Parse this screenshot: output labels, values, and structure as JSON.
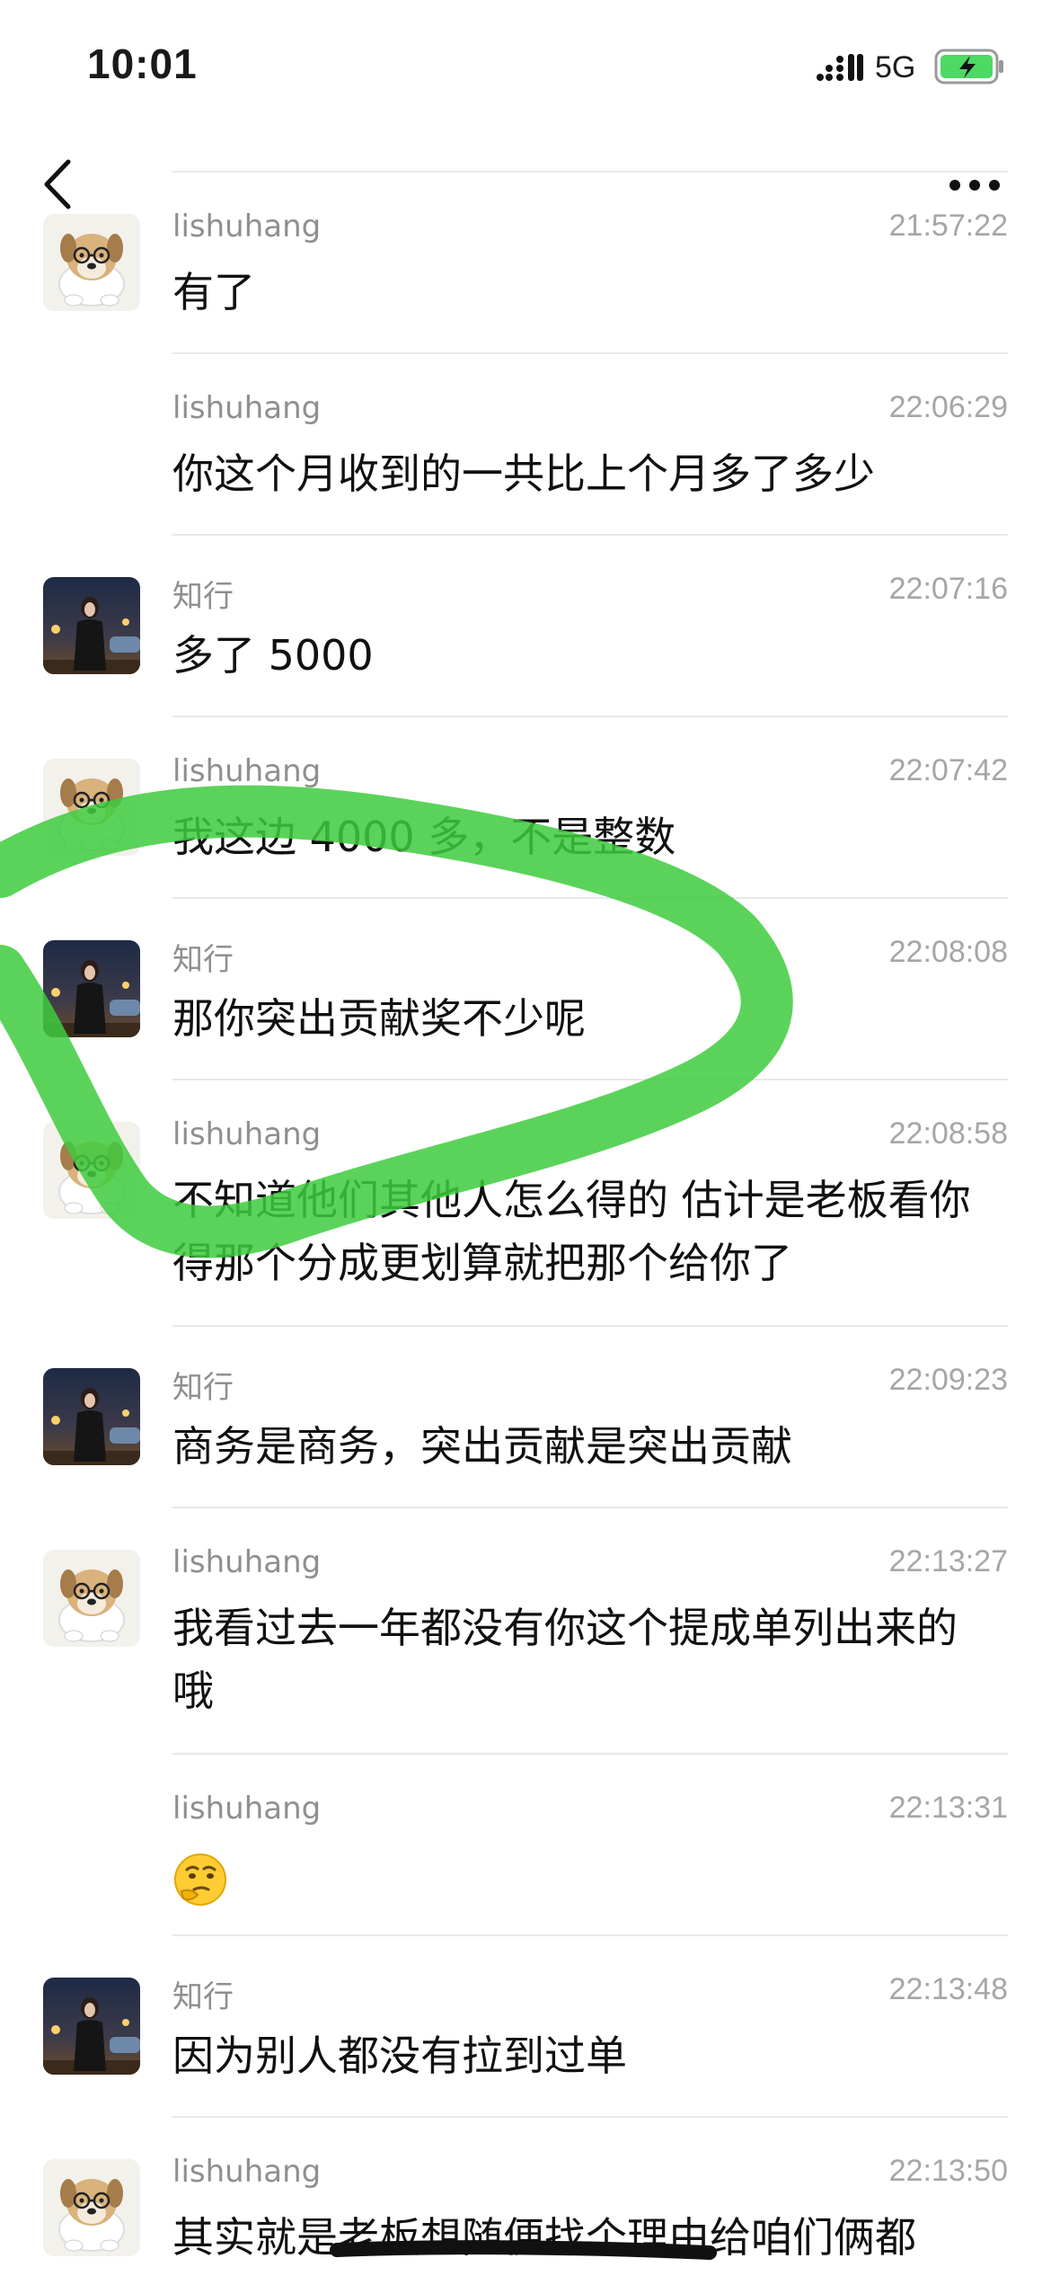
{
  "status_bar": {
    "time": "10:01",
    "network": "5G",
    "signal_icon": "signal-bars-icon",
    "battery_icon": "battery-charging-icon",
    "battery_color": "#4cd964"
  },
  "nav": {
    "back_icon": "chevron-left-icon",
    "more_icon": "more-dots-icon"
  },
  "colors": {
    "sender": "#8f8f8f",
    "time": "#a6a6a6",
    "divider": "#e8e8e8",
    "highlight_stroke": "#3ecb3e"
  },
  "messages": [
    {
      "sender": "lishuhang",
      "time": "21:57:22",
      "text": "有了",
      "avatar": "dog-avatar"
    },
    {
      "sender": "lishuhang",
      "time": "22:06:29",
      "text": "你这个月收到的一共比上个月多了多少",
      "avatar": ""
    },
    {
      "sender": "知行",
      "time": "22:07:16",
      "text": "多了 5000",
      "avatar": "woman-night-avatar"
    },
    {
      "sender": "lishuhang",
      "time": "22:07:42",
      "text": "我这边 4000 多，不是整数",
      "avatar": "dog-avatar"
    },
    {
      "sender": "知行",
      "time": "22:08:08",
      "text": "那你突出贡献奖不少呢",
      "avatar": "woman-night-avatar"
    },
    {
      "sender": "lishuhang",
      "time": "22:08:58",
      "text": "不知道他们其他人怎么得的 估计是老板看你得那个分成更划算就把那个给你了",
      "avatar": "dog-avatar"
    },
    {
      "sender": "知行",
      "time": "22:09:23",
      "text": "商务是商务，突出贡献是突出贡献",
      "avatar": "woman-night-avatar"
    },
    {
      "sender": "lishuhang",
      "time": "22:13:27",
      "text": "我看过去一年都没有你这个提成单列出来的哦",
      "avatar": "dog-avatar"
    },
    {
      "sender": "lishuhang",
      "time": "22:13:31",
      "text": "",
      "emoji": "thinking-face-emoji-icon",
      "avatar": ""
    },
    {
      "sender": "知行",
      "time": "22:13:48",
      "text": "因为别人都没有拉到过单",
      "avatar": "woman-night-avatar"
    },
    {
      "sender": "lishuhang",
      "time": "22:13:50",
      "text": "其实就是老板想随便找个理由给咱们俩都",
      "avatar": "dog-avatar"
    }
  ]
}
